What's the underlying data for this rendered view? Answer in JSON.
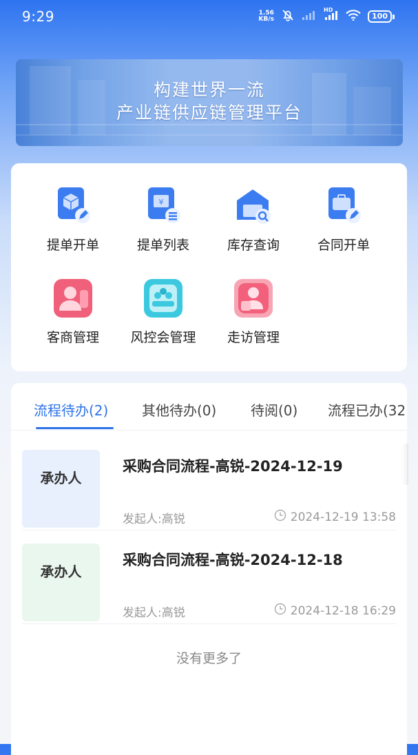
{
  "status_bar": {
    "time": "9:29",
    "net_speed_value": "1.56",
    "net_speed_unit": "KB/s",
    "signal_label": "HD",
    "battery": "100"
  },
  "banner": {
    "line1": "构建世界一流",
    "line2": "产业链供应链管理平台"
  },
  "grid": {
    "items": [
      {
        "label": "提单开单",
        "icon": "box-edit-icon"
      },
      {
        "label": "提单列表",
        "icon": "document-list-icon"
      },
      {
        "label": "库存查询",
        "icon": "warehouse-search-icon"
      },
      {
        "label": "合同开单",
        "icon": "briefcase-edit-icon"
      },
      {
        "label": "客商管理",
        "icon": "user-card-icon"
      },
      {
        "label": "风控会管理",
        "icon": "meeting-icon"
      },
      {
        "label": "走访管理",
        "icon": "visit-icon"
      }
    ]
  },
  "tabs": [
    {
      "label": "流程待办(2)",
      "active": true
    },
    {
      "label": "其他待办(0)",
      "active": false
    },
    {
      "label": "待阅(0)",
      "active": false
    },
    {
      "label": "流程已办(32",
      "active": false
    }
  ],
  "tasks": [
    {
      "badge": "承办人",
      "title": "采购合同流程-高锐-2024-12-19",
      "initiator": "发起人:高锐",
      "time": "2024-12-19 13:58",
      "badge_color": "#e8f0fe"
    },
    {
      "badge": "承办人",
      "title": "采购合同流程-高锐-2024-12-18",
      "initiator": "发起人:高锐",
      "time": "2024-12-18 16:29",
      "badge_color": "#eaf7ee"
    }
  ],
  "list_footer": "没有更多了",
  "colors": {
    "accent": "#2d73e8"
  }
}
